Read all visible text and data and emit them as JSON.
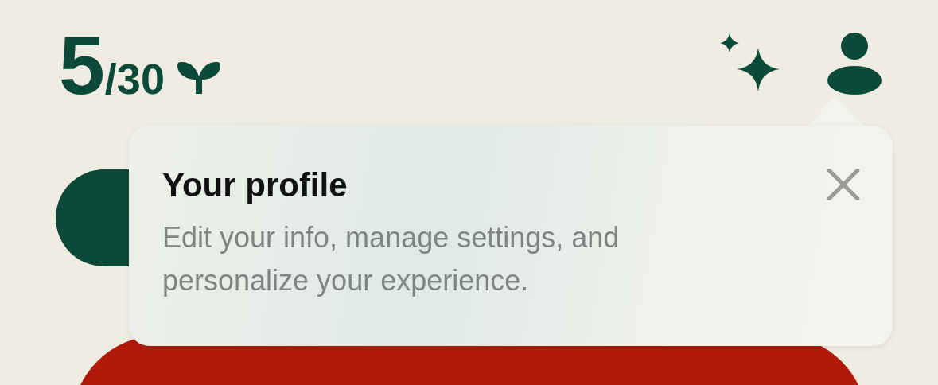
{
  "progress": {
    "current": "5",
    "total": "/30"
  },
  "tooltip": {
    "title": "Your profile",
    "body": "Edit your info, manage settings, and personalize your experience."
  }
}
